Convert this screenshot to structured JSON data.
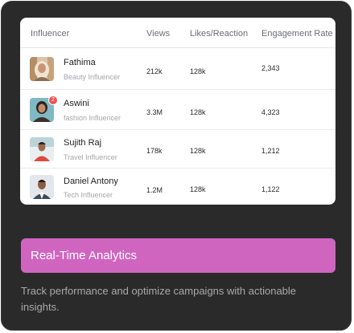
{
  "table": {
    "columns": [
      "Influencer",
      "Views",
      "Likes/Reaction",
      "Engagement Rate"
    ],
    "rows": [
      {
        "name": "Fathima",
        "role": "Beauty Influencer",
        "views": "212k",
        "likes": "128k",
        "engagement": "2,343",
        "avatar_icon": "woman-hijab-avatar"
      },
      {
        "name": "Aswini",
        "role": "fashion Influencer",
        "views": "3.3M",
        "likes": "128k",
        "engagement": "4,323",
        "avatar_icon": "woman-avatar",
        "badge": "2"
      },
      {
        "name": "Sujith Raj",
        "role": "Travel Influencer",
        "views": "178k",
        "likes": "128k",
        "engagement": "1,212",
        "avatar_icon": "man-outdoor-avatar"
      },
      {
        "name": "Daniel Antony",
        "role": "Tech Influencer",
        "views": "1.2M",
        "likes": "128k",
        "engagement": "1,122",
        "avatar_icon": "man-avatar"
      }
    ]
  },
  "feature": {
    "title": "Real-Time Analytics",
    "description": "Track performance and optimize campaigns with actionable insights."
  },
  "colors": {
    "card_background": "#2a2a2a",
    "banner": "#d065c0",
    "badge": "#ef5350"
  }
}
